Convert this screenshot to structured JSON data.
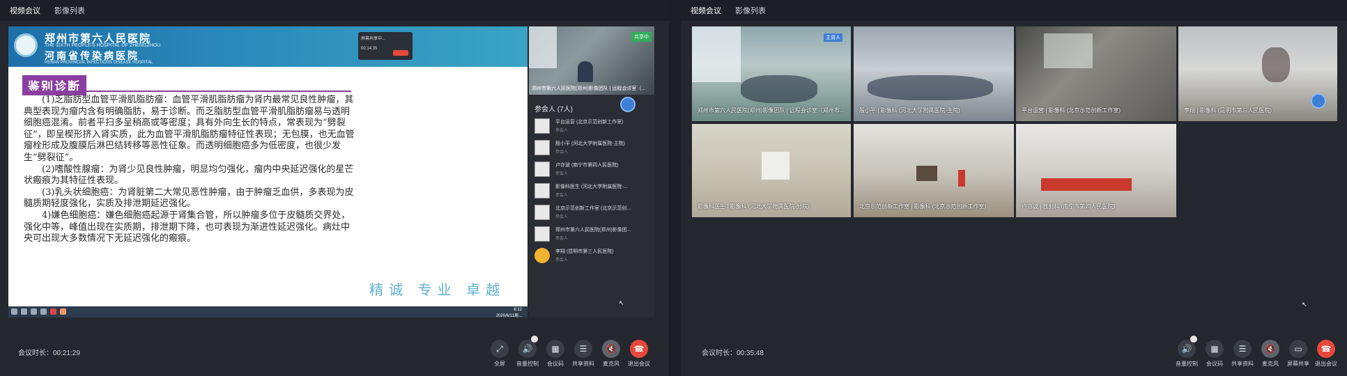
{
  "left": {
    "tabs": [
      "视频会议",
      "影像列表"
    ],
    "slide": {
      "hospital_cn": "郑州市第六人民医院",
      "hospital_en": "THE SIXTH PEOPLE'S HOSPITAL OF ZHENGZHOU",
      "hospital_cn2": "河南省传染病医院",
      "hospital_en2": "HENAN PROVINCIAL INFECTIOUS DISEASE HOSPITAL",
      "title": "鉴别诊断",
      "paragraphs": [
        "(1)乏脂肪型血管平滑肌脂肪瘤：血管平滑肌脂肪瘤为肾内最常见良性肿瘤，其典型表现为瘤内含有明确脂肪，易于诊断。而乏脂肪型血管平滑肌脂肪瘤易与透明细胞癌混淆。前者平扫多呈稍高或等密度；具有外向生长的特点，常表现为“劈裂征”，即呈楔形挤入肾实质，此为血管平滑肌脂肪瘤特征性表现；无包膜，也无血管瘤栓形成及腹膜后淋巴结转移等恶性征象。而透明细胞癌多为低密度，也很少发生“劈裂征”。",
        "(2)嗜酸性腺瘤：为肾少见良性肿瘤，明显均匀强化，瘤内中央延迟强化的星芒状瘢痕为其特征性表现。",
        "(3)乳头状细胞癌：为肾脏第二大常见恶性肿瘤，由于肿瘤乏血供，多表现为皮髓质期轻度强化，实质及排泄期延迟强化。",
        "4)嫌色细胞癌：嫌色细胞癌起源于肾集合管，所以肿瘤多位于皮髓质交界处，强化中等，峰值出现在实质期，排泄期下降，也可表现为渐进性延迟强化。病灶中央可出现大多数情况下无延迟强化的瘢痕。"
      ],
      "motto": "精诚 专业 卓越",
      "popup_text": "屏幕共享中...",
      "popup_time": "00:14:35",
      "taskbar_time": "8:12",
      "taskbar_date": "2020/6/11周..."
    },
    "side_video_label": "郑州市第六人民医院(郑州)影像团队 | 远程会诊室（...",
    "share_tag": "共享中",
    "participants_header": "参会人 (7人)",
    "participants": [
      {
        "name": "平台运营 (北京示范创新工作室)",
        "role": "参会人"
      },
      {
        "name": "殷小平 (河北大学附属医院-主院)",
        "role": "参会人"
      },
      {
        "name": "卢亦波 (南宁市第四人民医院)",
        "role": "参会人"
      },
      {
        "name": "影像科医生 (河北大学附属医院-...",
        "role": "参会人"
      },
      {
        "name": "北京示范创新工作室 (北京示范创...",
        "role": "参会人"
      },
      {
        "name": "郑州市第六人民医院(郑州)影像团...",
        "role": "参会人"
      },
      {
        "name": "李翔 (昆明市第三人民医院)",
        "role": "参会人"
      }
    ],
    "duration": "会议时长：00:21:29",
    "controls": [
      "全屏",
      "音量控制",
      "会议码",
      "共享资料",
      "麦克风",
      "退出会议"
    ]
  },
  "right": {
    "tabs": [
      "视频会议",
      "影像列表"
    ],
    "host_tag": "主讲人",
    "tiles": [
      "郑州市第六人民医院(郑州)影像团队 | 远程会诊室（郑州市...",
      "殷小平 | 影像科 (河北大学附属医院-主院)",
      "平台运营 | 影像科 (北京示范创新工作室)",
      "李翔 | 影像科 (昆明市第三人民医院)",
      "影像科医生 | 影像科 (河北大学附属医院-分院)",
      "北京示范创新工作室 | 影像科 (北京示范创新工作室)",
      "卢亦波 | 放射科 (南宁市第四人民医院)"
    ],
    "duration": "会议时长：00:35:48",
    "controls": [
      "音量控制",
      "会议码",
      "共享资料",
      "麦克风",
      "屏幕共享",
      "退出会议"
    ]
  }
}
